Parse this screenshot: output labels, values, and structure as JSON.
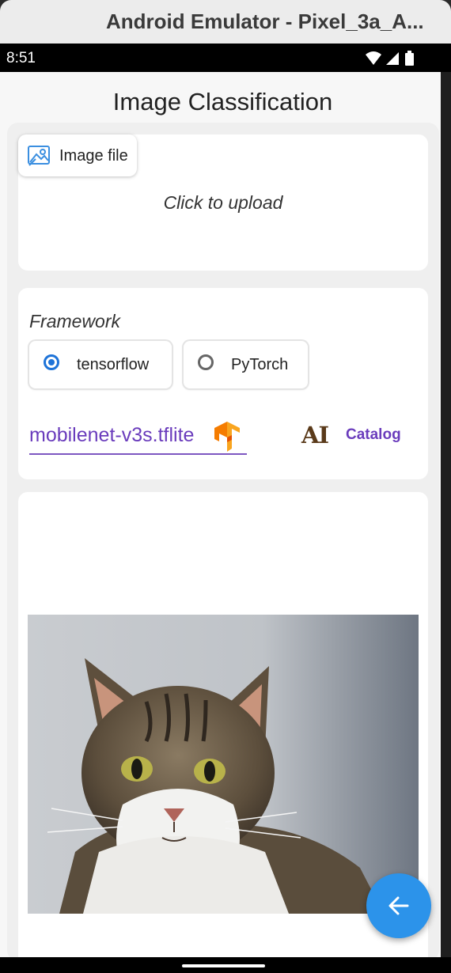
{
  "window": {
    "title": "Android Emulator - Pixel_3a_A..."
  },
  "status_bar": {
    "time": "8:51",
    "icons": [
      "wifi-icon",
      "signal-icon",
      "battery-icon"
    ]
  },
  "app": {
    "title": "Image Classification"
  },
  "upload": {
    "chip_label": "Image file",
    "hint": "Click to upload"
  },
  "framework": {
    "label": "Framework",
    "options": [
      {
        "label": "tensorflow",
        "selected": true
      },
      {
        "label": "PyTorch",
        "selected": false
      }
    ]
  },
  "model": {
    "value": "mobilenet-v3s.tflite",
    "catalog_logo": "AI",
    "catalog_label": "Catalog"
  },
  "image": {
    "subject": "tabby cat photo"
  },
  "fab": {
    "icon": "arrow-left-icon"
  },
  "colors": {
    "accent": "#6a3cbc",
    "radio": "#1e73d8",
    "fab": "#2c93ea"
  }
}
